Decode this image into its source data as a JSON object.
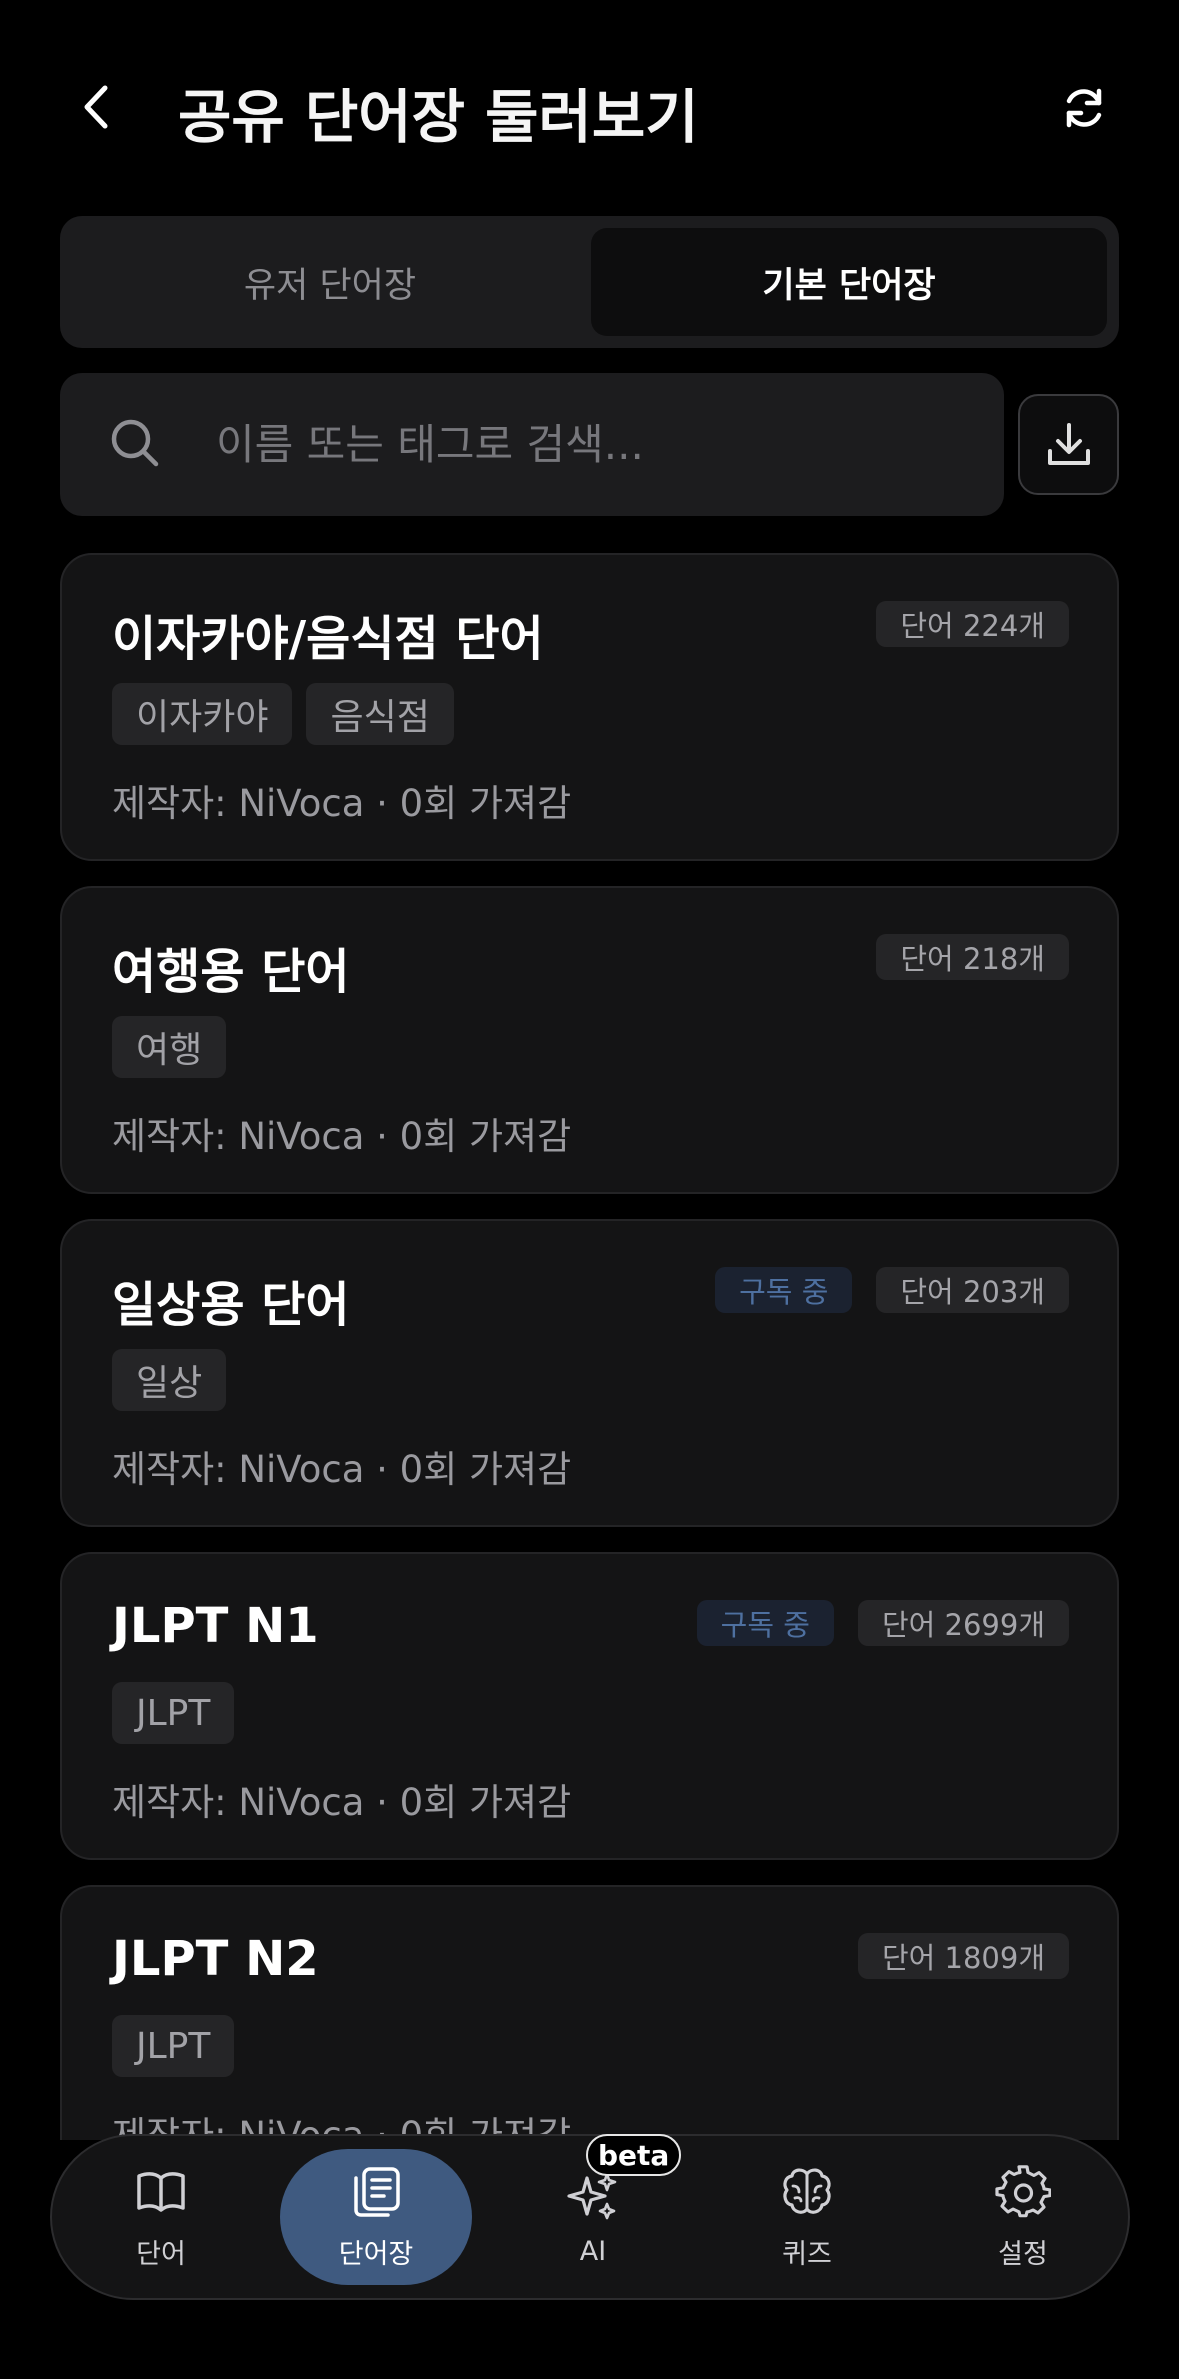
{
  "header": {
    "title": "공유 단어장 둘러보기"
  },
  "segmented": {
    "tabs": [
      {
        "label": "유저 단어장",
        "selected": false
      },
      {
        "label": "기본 단어장",
        "selected": true
      }
    ]
  },
  "search": {
    "placeholder": "이름 또는 태그로 검색..."
  },
  "cards": [
    {
      "title": "이자카야/음식점 단어",
      "subscribed": false,
      "subscribed_label": "",
      "count_label": "단어 224개",
      "tags": [
        "이자카야",
        "음식점"
      ],
      "meta": "제작자: NiVoca · 0회 가져감"
    },
    {
      "title": "여행용 단어",
      "subscribed": false,
      "subscribed_label": "",
      "count_label": "단어 218개",
      "tags": [
        "여행"
      ],
      "meta": "제작자: NiVoca · 0회 가져감"
    },
    {
      "title": "일상용 단어",
      "subscribed": true,
      "subscribed_label": "구독 중",
      "count_label": "단어 203개",
      "tags": [
        "일상"
      ],
      "meta": "제작자: NiVoca · 0회 가져감"
    },
    {
      "title": "JLPT N1",
      "subscribed": true,
      "subscribed_label": "구독 중",
      "count_label": "단어 2699개",
      "tags": [
        "JLPT"
      ],
      "meta": "제작자: NiVoca · 0회 가져감"
    },
    {
      "title": "JLPT N2",
      "subscribed": false,
      "subscribed_label": "",
      "count_label": "단어 1809개",
      "tags": [
        "JLPT"
      ],
      "meta": "제작자: NiVoca · 0회 가져감"
    }
  ],
  "bottom_nav": {
    "items": [
      {
        "label": "단어",
        "icon": "book-icon",
        "active": false
      },
      {
        "label": "단어장",
        "icon": "wordbook-icon",
        "active": true
      },
      {
        "label": "AI",
        "icon": "sparkles-icon",
        "active": false
      },
      {
        "label": "퀴즈",
        "icon": "brain-icon",
        "active": false
      },
      {
        "label": "설정",
        "icon": "gear-icon",
        "active": false
      }
    ],
    "beta_label": "beta"
  },
  "colors": {
    "background": "#000000",
    "card": "#141415",
    "accent": "#3f5a80",
    "subscribed_text": "#4e70a0"
  }
}
